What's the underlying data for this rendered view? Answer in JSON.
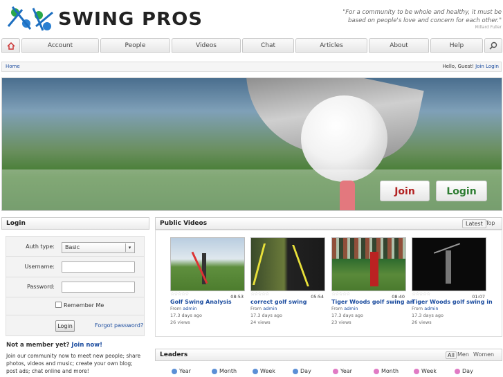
{
  "site": {
    "name": "SWING PROS",
    "quote": "\"For a community to be whole and healthy, it must be based on people's love and concern for each other.\"",
    "quote_author": "Millard Fuller"
  },
  "nav": [
    "Account",
    "People",
    "Videos",
    "Chat",
    "Articles",
    "About",
    "Help"
  ],
  "breadcrumb": {
    "home": "Home",
    "greeting": "Hello, Guest!",
    "join": "Join",
    "login": "Login"
  },
  "hero": {
    "join_label": "Join",
    "login_label": "Login"
  },
  "login": {
    "title": "Login",
    "auth_type_label": "Auth type:",
    "auth_type_value": "Basic",
    "username_label": "Username:",
    "password_label": "Password:",
    "remember_label": "Remember Me",
    "submit_label": "Login",
    "forgot_label": "Forgot password?",
    "not_member": "Not a member yet?",
    "join_now": "Join now!",
    "join_text": "Join our community now to meet new people; share photos, videos and music; create your own blog; post ads; chat online and more!"
  },
  "videos": {
    "title": "Public Videos",
    "tabs": [
      "Latest",
      "Top"
    ],
    "from_label": "From",
    "items": [
      {
        "title": "Golf Swing Analysis",
        "author": "admin",
        "age": "17.3 days ago",
        "views": "26 views",
        "duration": "08:53"
      },
      {
        "title": "correct golf swing",
        "author": "admin",
        "age": "17.3 days ago",
        "views": "24 views",
        "duration": "05:54"
      },
      {
        "title": "Tiger Woods golf swing ana",
        "author": "admin",
        "age": "17.3 days ago",
        "views": "23 views",
        "duration": "08:40"
      },
      {
        "title": "Tiger Woods golf swing in s",
        "author": "admin",
        "age": "17.3 days ago",
        "views": "26 views",
        "duration": "01:07"
      }
    ]
  },
  "leaders": {
    "title": "Leaders",
    "tabs": [
      "All",
      "Men",
      "Women"
    ],
    "men_periods": [
      "Year",
      "Month",
      "Week",
      "Day"
    ],
    "women_periods": [
      "Year",
      "Month",
      "Week",
      "Day"
    ]
  },
  "colors": {
    "link": "#1a4b9e",
    "join": "#b22222",
    "login": "#2e7d32",
    "male": "#5b8fd6",
    "female": "#e07ac4"
  }
}
